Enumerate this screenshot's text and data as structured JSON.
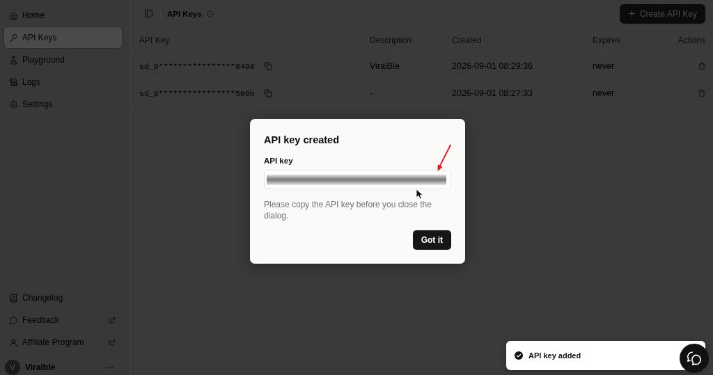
{
  "sidebar": {
    "items": [
      {
        "label": "Home",
        "selected": false
      },
      {
        "label": "API Keys",
        "selected": true
      },
      {
        "label": "Playground",
        "selected": false
      },
      {
        "label": "Logs",
        "selected": false
      },
      {
        "label": "Settings",
        "selected": false
      }
    ],
    "footer_links": [
      {
        "label": "Changelog",
        "external": false
      },
      {
        "label": "Feedback",
        "external": true
      },
      {
        "label": "Affiliate Program",
        "external": true
      }
    ],
    "user": {
      "initial": "V",
      "name": "Viralble"
    }
  },
  "header": {
    "title": "API Keys",
    "button": "Create API Key"
  },
  "table": {
    "columns": [
      "API Key",
      "Description",
      "Created",
      "Expires",
      "Actions"
    ],
    "rows": [
      {
        "key": "sd_0****************8498",
        "description": "ViralBle",
        "created": "2026-09-01 08:29:36",
        "expires": "never"
      },
      {
        "key": "sd_6****************509b",
        "description": "-",
        "created": "2026-09-01 08:27:33",
        "expires": "never"
      }
    ]
  },
  "dialog": {
    "title": "API key created",
    "field_label": "API key",
    "key_blurred": true,
    "message": "Please copy the API key before you close the dialog.",
    "button": "Got it"
  },
  "toast": {
    "message": "API key added"
  }
}
